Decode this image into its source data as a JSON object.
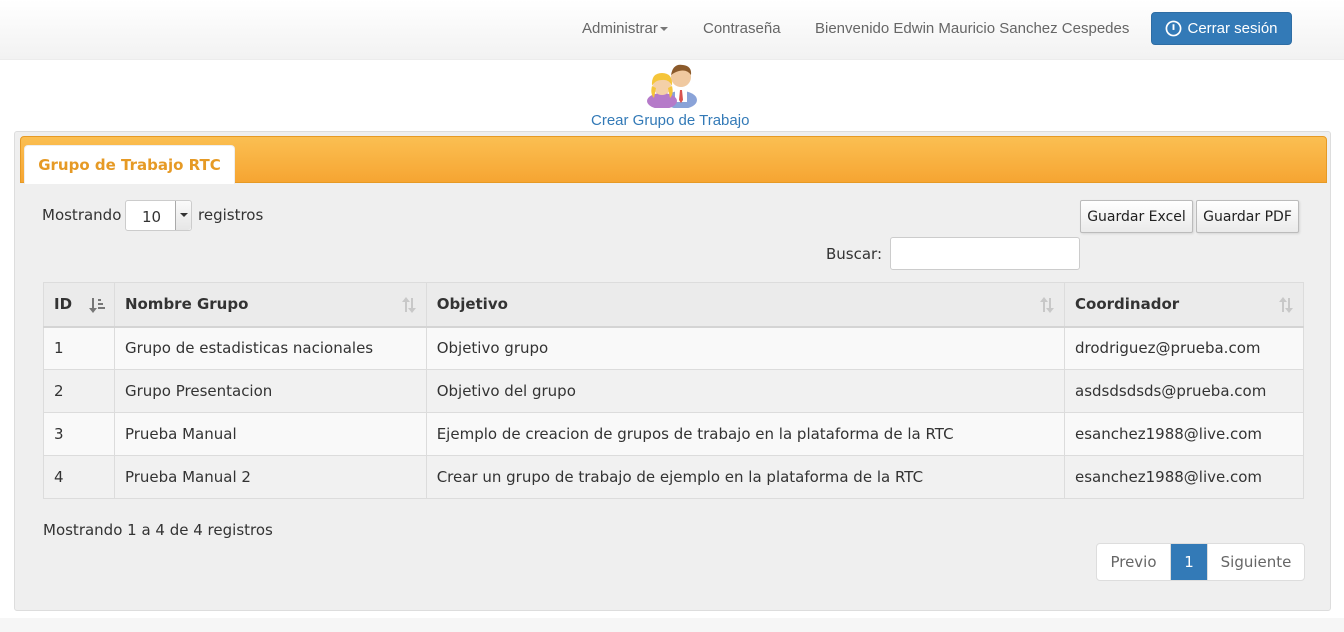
{
  "navbar": {
    "admin_label": "Administrar",
    "password_label": "Contraseña",
    "welcome_text": "Bienvenido Edwin Mauricio Sanchez Cespedes",
    "logout_label": "Cerrar sesión",
    "logout_icon": "power-icon",
    "accent_color": "#337ab7"
  },
  "create": {
    "icon": "users-group-icon",
    "label": "Crear Grupo de Trabajo"
  },
  "panel": {
    "tab_label": "Grupo de Trabajo RTC",
    "tab_color": "#f6a532",
    "length": {
      "prefix": "Mostrando",
      "value": "10",
      "suffix": "registros"
    },
    "export": {
      "excel_label": "Guardar Excel",
      "pdf_label": "Guardar PDF"
    },
    "search": {
      "label": "Buscar:",
      "value": ""
    },
    "table": {
      "columns": [
        "ID",
        "Nombre Grupo",
        "Objetivo",
        "Coordinador"
      ],
      "rows": [
        [
          "1",
          "Grupo de estadisticas nacionales",
          "Objetivo grupo",
          "drodriguez@prueba.com"
        ],
        [
          "2",
          "Grupo Presentacion",
          "Objetivo del grupo",
          "asdsdsdsds@prueba.com"
        ],
        [
          "3",
          "Prueba Manual",
          "Ejemplo de creacion de grupos de trabajo en la plataforma de la RTC",
          "esanchez1988@live.com"
        ],
        [
          "4",
          "Prueba Manual 2",
          "Crear un grupo de trabajo de ejemplo en la plataforma de la RTC",
          "esanchez1988@live.com"
        ]
      ]
    },
    "info_text": "Mostrando 1 a 4 de 4 registros",
    "pagination": {
      "prev_label": "Previo",
      "current_page": "1",
      "next_label": "Siguiente"
    }
  }
}
